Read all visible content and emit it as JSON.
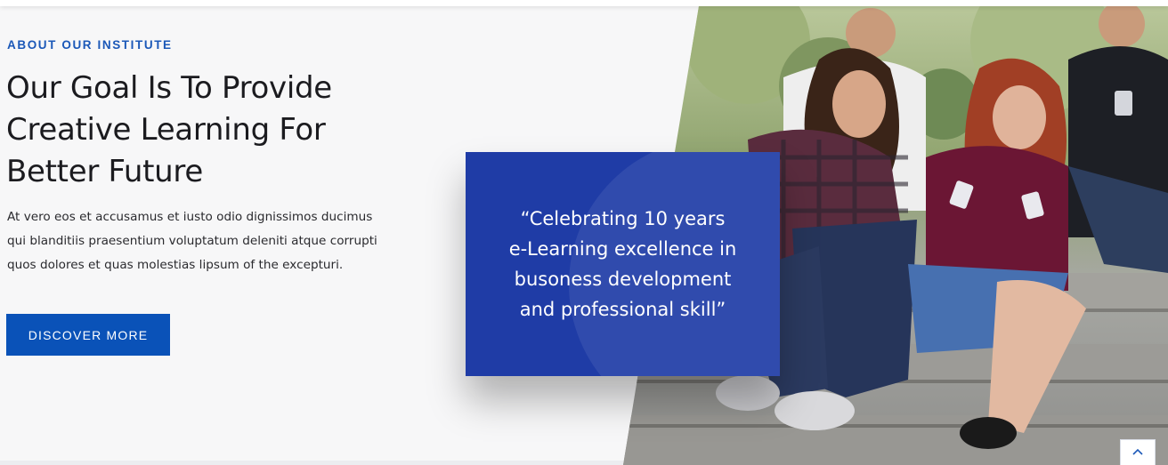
{
  "about": {
    "eyebrow": "ABOUT OUR INSTITUTE",
    "headline_lines": [
      "Our Goal Is To Provide",
      "Creative Learning For",
      "Better Future"
    ],
    "body_lines": [
      "At vero eos et accusamus et iusto odio dignissimos ducimus",
      "qui blanditiis praesentium voluptatum deleniti atque corrupti",
      "quos dolores et quas molestias lipsum of the excepturi."
    ],
    "cta_label": "DISCOVER MORE"
  },
  "quote": {
    "lines": [
      "“Celebrating 10 years",
      "e-Learning excellence in",
      "busoness development",
      "and professional skill”"
    ]
  },
  "icons": {
    "back_to_top": "chevron-up-icon",
    "photo": "students-photo"
  },
  "colors": {
    "accent": "#1b58b8",
    "button": "#0a52b8",
    "quote_card": "#1f3ca6",
    "heading": "#1b1b1f"
  }
}
